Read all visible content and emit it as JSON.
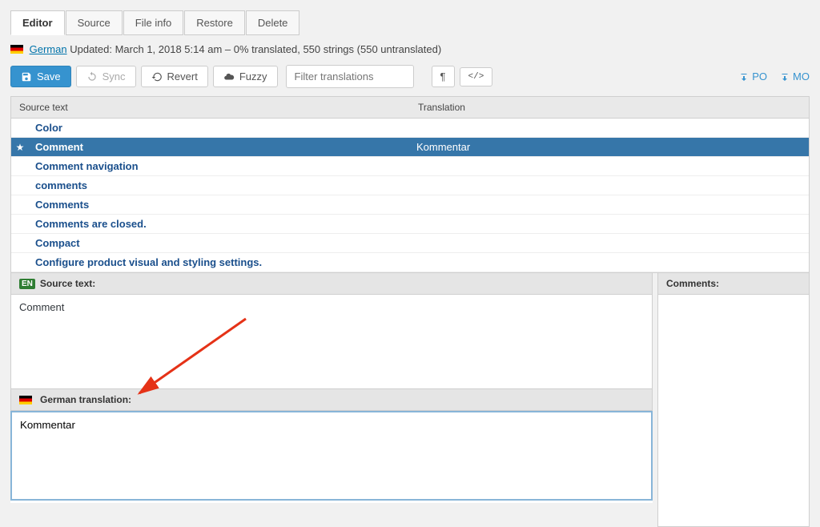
{
  "tabs": {
    "editor": "Editor",
    "source": "Source",
    "fileinfo": "File info",
    "restore": "Restore",
    "delete": "Delete"
  },
  "info": {
    "lang_link": "German",
    "status": "Updated: March 1, 2018 5:14 am – 0% translated, 550 strings (550 untranslated)"
  },
  "toolbar": {
    "save": "Save",
    "sync": "Sync",
    "revert": "Revert",
    "fuzzy": "Fuzzy",
    "filter_placeholder": "Filter translations",
    "po": "PO",
    "mo": "MO"
  },
  "table": {
    "head_source": "Source text",
    "head_translation": "Translation",
    "rows": [
      {
        "src": "Color",
        "trn": ""
      },
      {
        "src": "Comment",
        "trn": "Kommentar"
      },
      {
        "src": "Comment navigation",
        "trn": ""
      },
      {
        "src": "comments",
        "trn": ""
      },
      {
        "src": "Comments",
        "trn": ""
      },
      {
        "src": "Comments are closed.",
        "trn": ""
      },
      {
        "src": "Compact",
        "trn": ""
      },
      {
        "src": "Configure product visual and styling settings.",
        "trn": ""
      }
    ]
  },
  "panels": {
    "source_label": "Source text:",
    "source_value": "Comment",
    "trans_label": "German translation:",
    "trans_value": "Kommentar",
    "comments_label": "Comments:"
  },
  "badges": {
    "en": "EN"
  }
}
